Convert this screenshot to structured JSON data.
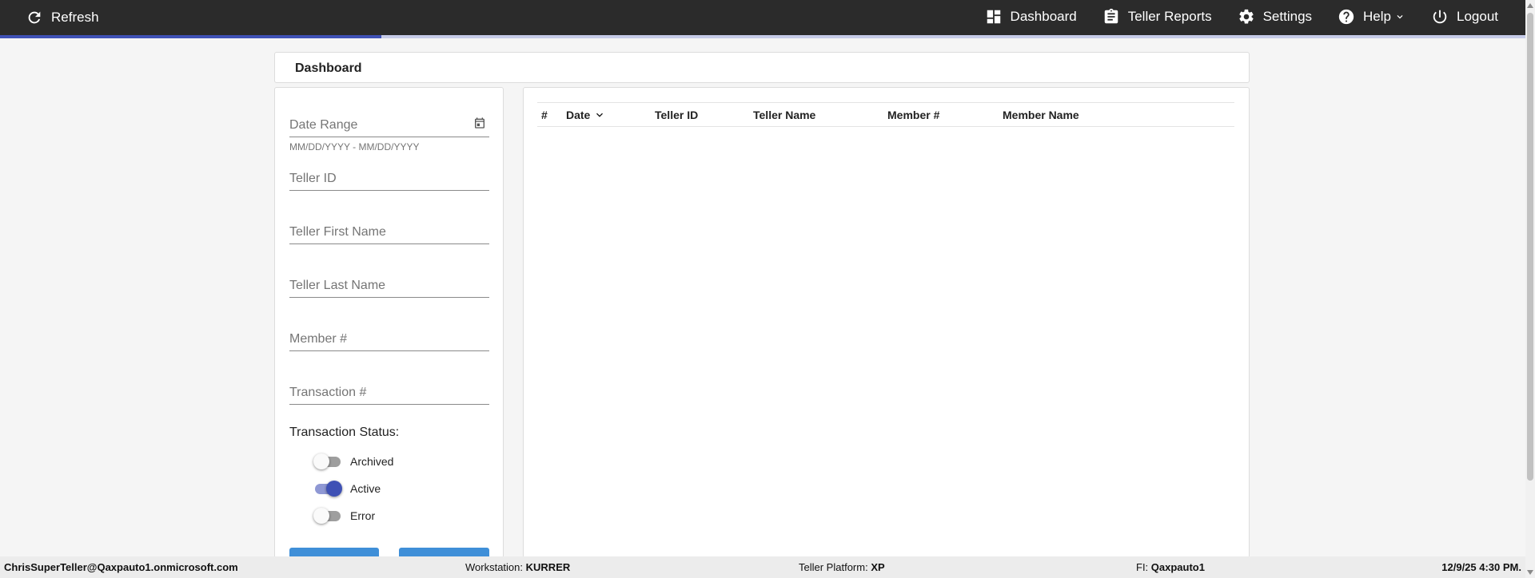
{
  "topbar": {
    "refresh_label": "Refresh",
    "nav": [
      {
        "label": "Dashboard",
        "icon": "dashboard-icon"
      },
      {
        "label": "Teller Reports",
        "icon": "clipboard-icon"
      },
      {
        "label": "Settings",
        "icon": "gear-icon"
      },
      {
        "label": "Help",
        "icon": "help-circle-icon"
      },
      {
        "label": "Logout",
        "icon": "power-icon"
      }
    ],
    "load_progress": 0.25
  },
  "page": {
    "title": "Dashboard"
  },
  "filters": {
    "date_range": {
      "label": "Date Range",
      "hint": "MM/DD/YYYY - MM/DD/YYYY"
    },
    "teller_id": "Teller ID",
    "teller_first_name": "Teller First Name",
    "teller_last_name": "Teller Last Name",
    "member_number": "Member #",
    "transaction_number": "Transaction #",
    "status_label": "Transaction Status:",
    "statuses": [
      {
        "label": "Archived",
        "on": false
      },
      {
        "label": "Active",
        "on": true
      },
      {
        "label": "Error",
        "on": false
      }
    ]
  },
  "table": {
    "columns": [
      "#",
      "Date",
      "Teller ID",
      "Teller Name",
      "Member #",
      "Member Name"
    ],
    "sorted_column": "Date",
    "rows": []
  },
  "footer": {
    "user": "ChrisSuperTeller@Qaxpauto1.onmicrosoft.com",
    "workstation_label": "Workstation:",
    "workstation": "KURRER",
    "platform_label": "Teller Platform:",
    "platform": "XP",
    "fi_label": "FI:",
    "fi": "Qaxpauto1",
    "datetime": "12/9/25 4:30 PM."
  },
  "colors": {
    "topbar": "#2b2b2b",
    "accent": "#3f51b5",
    "button": "#3f8fd8"
  }
}
